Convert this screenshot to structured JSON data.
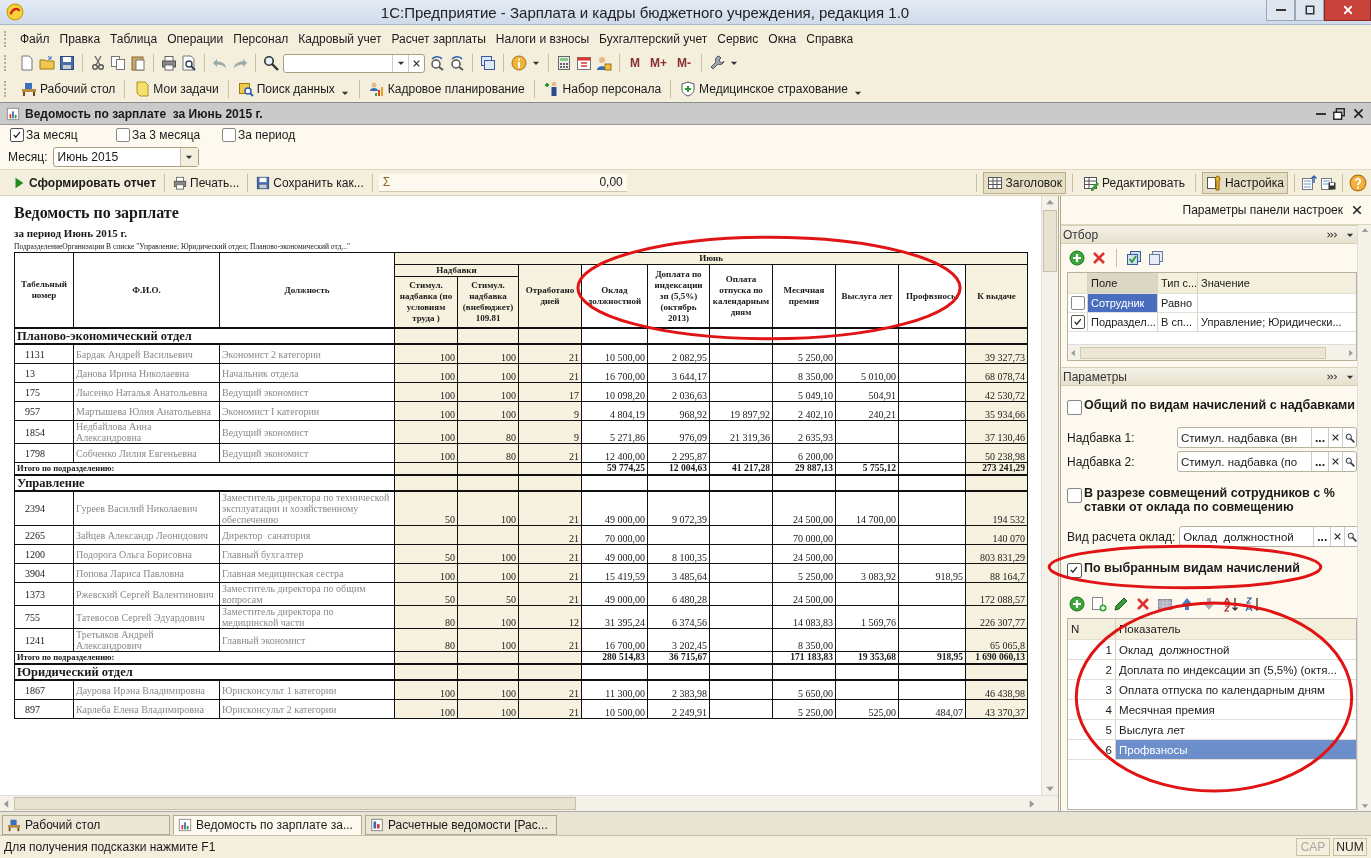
{
  "window": {
    "title": "1С:Предприятие - Зарплата и кадры бюджетного учреждения, редакция 1.0"
  },
  "menu": [
    "Файл",
    "Правка",
    "Таблица",
    "Операции",
    "Персонал",
    "Кадровый учет",
    "Расчет зарплаты",
    "Налоги и взносы",
    "Бухгалтерский учет",
    "Сервис",
    "Окна",
    "Справка"
  ],
  "toolbar": {
    "memory_buttons": [
      "M",
      "M+",
      "M-"
    ]
  },
  "panel_bar": [
    {
      "label": "Рабочий стол",
      "has_menu": false
    },
    {
      "label": "Мои задачи",
      "has_menu": false
    },
    {
      "label": "Поиск данных",
      "has_menu": true
    },
    {
      "label": "Кадровое планирование",
      "has_menu": false
    },
    {
      "label": "Набор персонала",
      "has_menu": false
    },
    {
      "label": "Медицинское страхование",
      "has_menu": true
    }
  ],
  "document": {
    "title": "Ведомость по зарплате  за Июнь 2015 г.",
    "period_options": [
      {
        "label": "За месяц",
        "checked": true
      },
      {
        "label": "За 3 месяца",
        "checked": false
      },
      {
        "label": "За период",
        "checked": false
      }
    ],
    "month": {
      "label": "Месяц:",
      "value": "Июнь 2015"
    },
    "commands": [
      {
        "label": "Сформировать отчет",
        "kind": "run"
      },
      {
        "label": "Печать...",
        "kind": "print"
      },
      {
        "label": "Сохранить как...",
        "kind": "save"
      }
    ],
    "sum": {
      "symbol": "Σ",
      "value": "0,00"
    },
    "view_buttons": [
      {
        "label": "Заголовок",
        "pressed": true
      },
      {
        "label": "Редактировать",
        "pressed": false
      },
      {
        "label": "Настройка",
        "pressed": true
      }
    ],
    "report": {
      "title": "Ведомость по зарплате",
      "subtitle": "за период Июнь 2015 г.",
      "filter_text": "ПодразделениеОрганизации В списке \"Управление; Юридический отдел; Планово-экономический отд...\"",
      "fixed_columns": [
        "Табельный номер",
        "Ф.И.О.",
        "Должность"
      ],
      "period": "Июнь",
      "group": "Надбавки",
      "group_columns": [
        "Стимул. надбавка (по условиям труда )",
        "Стимул. надбавка (внебюджет) 109.81"
      ],
      "columns": [
        "Отработано дней",
        "Оклад должностной",
        "Доплата по индексации зп (5,5%) (октябрь 2013)",
        "Оплата отпуска по календарным дням",
        "Месячная премия",
        "Выслуга лет",
        "Профвзносы",
        "К выдаче"
      ],
      "sections": [
        {
          "name": "Планово-экономический отдел",
          "rows": [
            {
              "cells": [
                "1131",
                "Бардак Андрей Васильевич",
                "Экономист 2 категории",
                "100",
                "100",
                "21",
                "10 500,00",
                "2 082,95",
                null,
                "5 250,00",
                null,
                null,
                "39 327,73"
              ]
            },
            {
              "cells": [
                "13",
                "Данова Ирина Николаевна",
                "Начальник отдела",
                "100",
                "100",
                "21",
                "16 700,00",
                "3 644,17",
                null,
                "8 350,00",
                "5 010,00",
                null,
                "68 078,74"
              ]
            },
            {
              "cells": [
                "175",
                "Лысенко Наталья Анатольевна",
                "Ведущий экономист",
                "100",
                "100",
                "17",
                "10 098,20",
                "2 036,63",
                null,
                "5 049,10",
                "504,91",
                null,
                "42 530,72"
              ]
            },
            {
              "cells": [
                "957",
                "Мартышева Юлия Анатольевна",
                "Экономист I категории",
                "100",
                "100",
                "9",
                "4 804,19",
                "968,92",
                "19 897,92",
                "2 402,10",
                "240,21",
                null,
                "35 934,66"
              ]
            },
            {
              "cells": [
                "1854",
                "Недбайлова Анна Александровна",
                "Ведущий экономист",
                "100",
                "80",
                "9",
                "5 271,86",
                "976,09",
                "21 319,36",
                "2 635,93",
                null,
                null,
                "37 130,46"
              ]
            },
            {
              "cells": [
                "1798",
                "Собченко Лилия Евгеньевна",
                "Ведущий экономист",
                "100",
                "80",
                "21",
                "12 400,00",
                "2 295,87",
                null,
                "6 200,00",
                null,
                null,
                "50 238,98"
              ]
            }
          ],
          "total": {
            "label": "Итого по подразделению:",
            "cells": [
              null,
              null,
              null,
              "59 774,25",
              "12 004,63",
              "41 217,28",
              "29 887,13",
              "5 755,12",
              null,
              "273 241,29"
            ]
          }
        },
        {
          "name": "Управление",
          "rows": [
            {
              "cells": [
                "2394",
                "Гуреев Василий Николаевич",
                "Заместитель директора по технической эксплуатации и хозяйственному обеспечению",
                "50",
                "100",
                "21",
                "49 000,00",
                "9 072,39",
                null,
                "24 500,00",
                "14 700,00",
                null,
                "194 532"
              ]
            },
            {
              "cells": [
                "2265",
                "Зайцев Александр Леонидович",
                "Директор  санатория",
                null,
                null,
                "21",
                "70 000,00",
                null,
                null,
                "70 000,00",
                null,
                null,
                "140 070"
              ]
            },
            {
              "cells": [
                "1200",
                "Подорога Ольга Борисовна",
                "Главный бухгалтер",
                "50",
                "100",
                "21",
                "49 000,00",
                "8 100,35",
                null,
                "24 500,00",
                null,
                null,
                "803 831,29"
              ]
            },
            {
              "cells": [
                "3904",
                "Попова Лариса Павловна",
                "Главная медицинская сестра",
                "100",
                "100",
                "21",
                "15 419,59",
                "3 485,64",
                null,
                "5 250,00",
                "3 083,92",
                "918,95",
                "88 164,7"
              ]
            },
            {
              "cells": [
                "1373",
                "Ржевский Сергей Валентинович",
                "Заместитель директора по общим вопросам",
                "50",
                "50",
                "21",
                "49 000,00",
                "6 480,28",
                null,
                "24 500,00",
                null,
                null,
                "172 088,57"
              ]
            },
            {
              "cells": [
                "755",
                "Татевосов Сергей Эдуардович",
                "Заместитель директора по медицинской части",
                "80",
                "100",
                "12",
                "31 395,24",
                "6 374,56",
                null,
                "14 083,83",
                "1 569,76",
                null,
                "226 307,77"
              ]
            },
            {
              "cells": [
                "1241",
                "Третьяков Андрей Александрович",
                "Главный экономист",
                "80",
                "100",
                "21",
                "16 700,00",
                "3 202,45",
                null,
                "8 350,00",
                null,
                null,
                "65 065,8"
              ]
            }
          ],
          "total": {
            "label": "Итого по подразделению:",
            "cells": [
              null,
              null,
              null,
              "280 514,83",
              "36 715,67",
              null,
              "171 183,83",
              "19 353,68",
              "918,95",
              "1 690 060,13"
            ]
          }
        },
        {
          "name": "Юридический отдел",
          "rows": [
            {
              "cells": [
                "1867",
                "Даурова Ирэна Владимировна",
                "Юрисконсульт 1 категории",
                "100",
                "100",
                "21",
                "11 300,00",
                "2 383,98",
                null,
                "5 650,00",
                null,
                null,
                "46 438,98"
              ]
            },
            {
              "cells": [
                "897",
                "Карлеба Елена Владимировна",
                "Юрисконсульт 2 категории",
                "100",
                "100",
                "21",
                "10 500,00",
                "2 249,91",
                null,
                "5 250,00",
                "525,00",
                "484,07",
                "43 370,37"
              ]
            }
          ]
        }
      ]
    },
    "settings_panel": {
      "title": "Параметры панели настроек",
      "filter": {
        "title": "Отбор",
        "columns": [
          "Поле",
          "Тип с...",
          "Значение"
        ],
        "rows": [
          {
            "checked": false,
            "selected": true,
            "cells": [
              "Сотрудник",
              "Равно",
              null
            ]
          },
          {
            "checked": true,
            "selected": false,
            "cells": [
              "Подраздел...",
              "В сп...",
              "Управление; Юридически..."
            ]
          }
        ]
      },
      "parameters": {
        "title": "Параметры",
        "items": [
          {
            "kind": "checkbox",
            "label": "Общий по видам начислений с надбавками",
            "checked": false
          },
          {
            "kind": "field",
            "label": "Надбавка 1:",
            "value": "Стимул. надбавка (вн",
            "select_label": "..."
          },
          {
            "kind": "field",
            "label": "Надбавка 2:",
            "value": "Стимул. надбавка (по",
            "select_label": "..."
          },
          {
            "kind": "checkbox",
            "label": "В разрезе совмещений сотрудников с % ставки от оклада по совмещению",
            "checked": false
          },
          {
            "kind": "field",
            "label": "Вид расчета оклад:",
            "value": "Оклад  должностной",
            "select_label": "..."
          },
          {
            "kind": "checkbox",
            "label": "По выбранным видам начислений",
            "checked": true
          }
        ]
      },
      "indicators": {
        "columns": [
          "N",
          "Показатель"
        ],
        "rows": [
          {
            "n": "1",
            "name": "Оклад  должностной",
            "selected": false
          },
          {
            "n": "2",
            "name": "Доплата по индексации зп (5,5%) (октя...",
            "selected": false
          },
          {
            "n": "3",
            "name": "Оплата отпуска по календарным дням",
            "selected": false
          },
          {
            "n": "4",
            "name": "Месячная премия",
            "selected": false
          },
          {
            "n": "5",
            "name": "Выслуга лет",
            "selected": false
          },
          {
            "n": "6",
            "name": "Профвзносы",
            "selected": true
          }
        ]
      }
    }
  },
  "taskbar": [
    {
      "label": "Рабочий стол",
      "selected": false
    },
    {
      "label": "Ведомость по зарплате  за...",
      "selected": true
    },
    {
      "label": "Расчетные ведомости [Рас...",
      "selected": false
    }
  ],
  "status_bar": {
    "hint": "Для получения подсказки нажмите F1",
    "indicators": [
      {
        "label": "CAP",
        "on": false
      },
      {
        "label": "NUM",
        "on": true
      }
    ]
  },
  "highlights": [
    {
      "kind": "report-columns"
    },
    {
      "kind": "option"
    },
    {
      "kind": "indicator-list"
    }
  ]
}
